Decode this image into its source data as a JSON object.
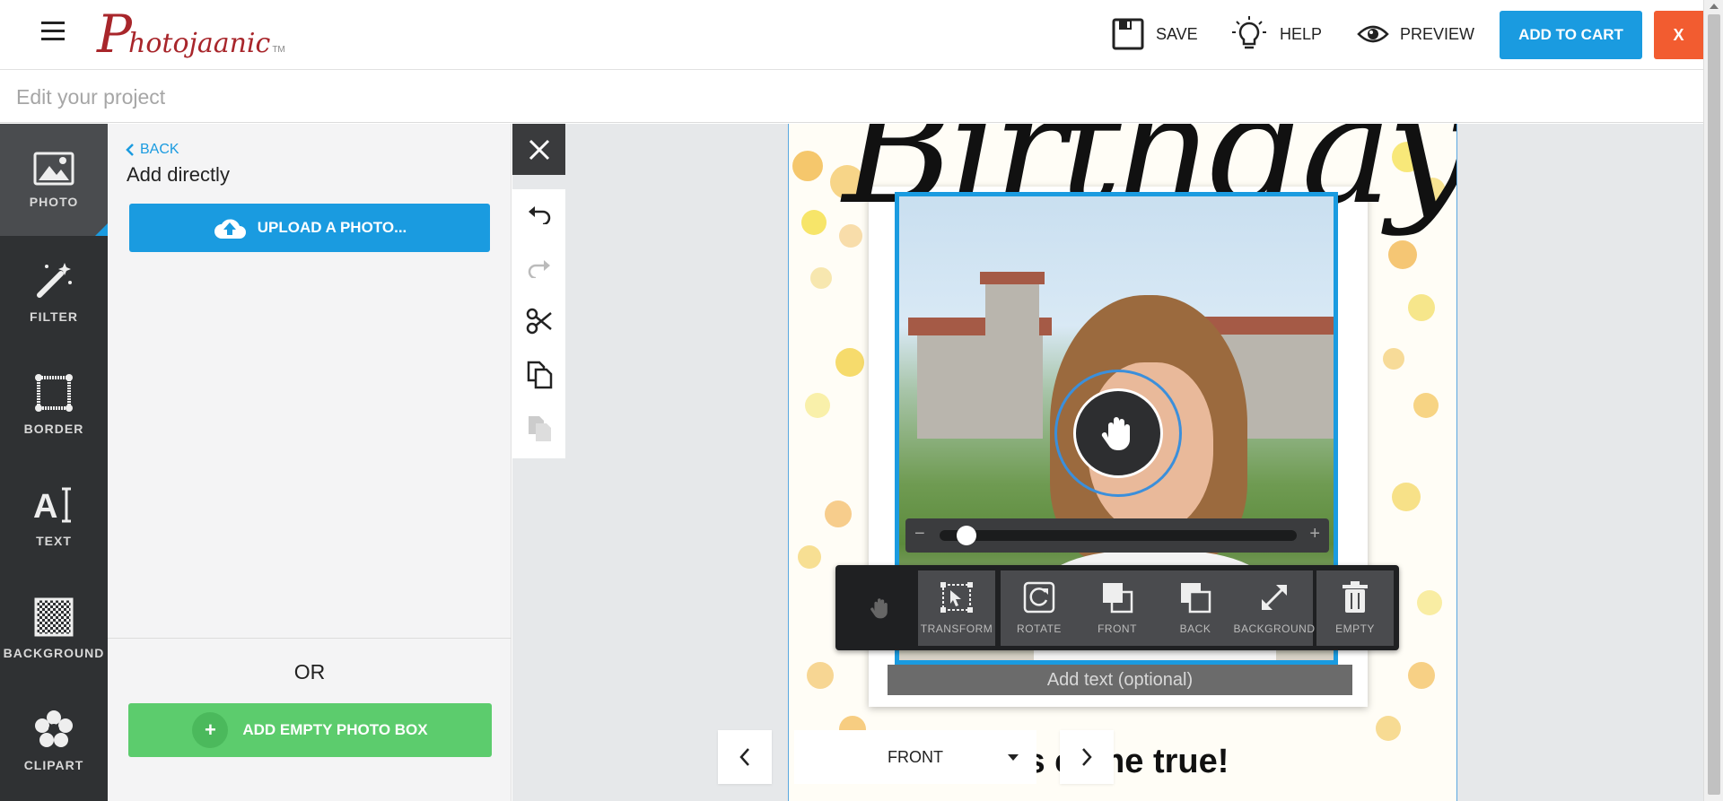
{
  "header": {
    "logo_initial": "P",
    "logo_rest": "hotojaanic",
    "logo_tm": "TM",
    "save_label": "SAVE",
    "help_label": "HELP",
    "preview_label": "PREVIEW",
    "add_to_cart_label": "ADD TO CART",
    "close_label": "X"
  },
  "project_title_placeholder": "Edit your project",
  "sidebar": {
    "items": [
      {
        "label": "PHOTO",
        "icon": "photo-icon",
        "active": true
      },
      {
        "label": "FILTER",
        "icon": "magic-wand-icon"
      },
      {
        "label": "BORDER",
        "icon": "border-icon"
      },
      {
        "label": "TEXT",
        "icon": "text-icon"
      },
      {
        "label": "BACKGROUND",
        "icon": "checkerboard-icon"
      },
      {
        "label": "CLIPART",
        "icon": "flower-icon"
      }
    ]
  },
  "panel": {
    "back_label": "BACK",
    "heading": "Add directly",
    "upload_label": "UPLOAD A PHOTO...",
    "or_label": "OR",
    "empty_box_label": "ADD EMPTY PHOTO BOX",
    "empty_box_plus": "+"
  },
  "card": {
    "headline": "Birthday",
    "caption_placeholder": "Add text (optional)",
    "footer_text": "ou    shes come true!"
  },
  "zoom": {
    "minus": "−",
    "plus": "+",
    "level": 0.05
  },
  "float_toolbar": {
    "items": [
      {
        "label": "TRANSFORM",
        "icon": "transform-icon"
      },
      {
        "label": "ROTATE",
        "icon": "rotate-icon"
      },
      {
        "label": "FRONT",
        "icon": "bring-front-icon"
      },
      {
        "label": "BACK",
        "icon": "send-back-icon"
      },
      {
        "label": "BACKGROUND",
        "icon": "expand-icon"
      },
      {
        "label": "EMPTY",
        "icon": "trash-icon"
      }
    ]
  },
  "page_nav": {
    "current_page": "FRONT"
  },
  "colors": {
    "accent_blue": "#1a9be0",
    "close_orange": "#f25c30",
    "green": "#5ccc6d",
    "nav_dark": "#2f3133",
    "logo_red": "#a8262b"
  }
}
